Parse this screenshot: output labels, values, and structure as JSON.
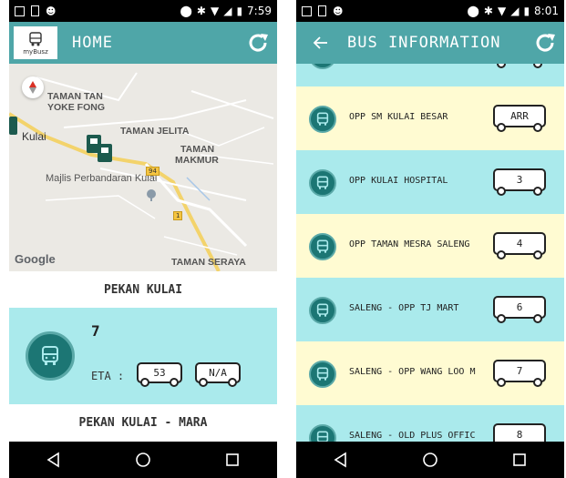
{
  "left": {
    "status": {
      "time": "7:59"
    },
    "appbar": {
      "title": "HOME",
      "logo_text": "myBusz"
    },
    "map": {
      "labels": {
        "taman_tan": "TAMAN TAN",
        "yoke_fong": "YOKE FONG",
        "taman_jelita": "TAMAN JELITA",
        "kulai": "Kulai",
        "taman": "TAMAN",
        "makmur": "MAKMUR",
        "majlis": "Majlis Perbandaran Kulai",
        "taman_seraya": "TAMAN SERAYA",
        "route_94": "94",
        "route_1": "1"
      },
      "google": "Google"
    },
    "stop_title": "PEKAN KULAI",
    "bus_card": {
      "route": "7",
      "eta_label": "ETA :",
      "eta_1": "53",
      "eta_2": "N/A"
    },
    "next_stop": "PEKAN KULAI - MARA"
  },
  "right": {
    "status": {
      "time": "8:01"
    },
    "appbar": {
      "title": "BUS INFORMATION"
    },
    "rows": [
      {
        "stop": "",
        "eta": ""
      },
      {
        "stop": "OPP SM KULAI BESAR",
        "eta": "ARR"
      },
      {
        "stop": "OPP KULAI HOSPITAL",
        "eta": "3"
      },
      {
        "stop": "OPP TAMAN MESRA SALENG",
        "eta": "4"
      },
      {
        "stop": "SALENG - OPP TJ MART",
        "eta": "6"
      },
      {
        "stop": "SALENG - OPP WANG LOO M",
        "eta": "7"
      },
      {
        "stop": "SALENG - OLD PLUS OFFIC",
        "eta": "8"
      }
    ]
  },
  "colors": {
    "teal_bar": "#4fa6a8",
    "row_blue": "#aaeaec",
    "row_yellow": "#fffbd2",
    "bus_icon": "#1c7674"
  },
  "icons": [
    "refresh-icon",
    "back-arrow-icon",
    "bus-icon",
    "compass-icon",
    "nav-back-icon",
    "nav-home-icon",
    "nav-recents-icon"
  ]
}
